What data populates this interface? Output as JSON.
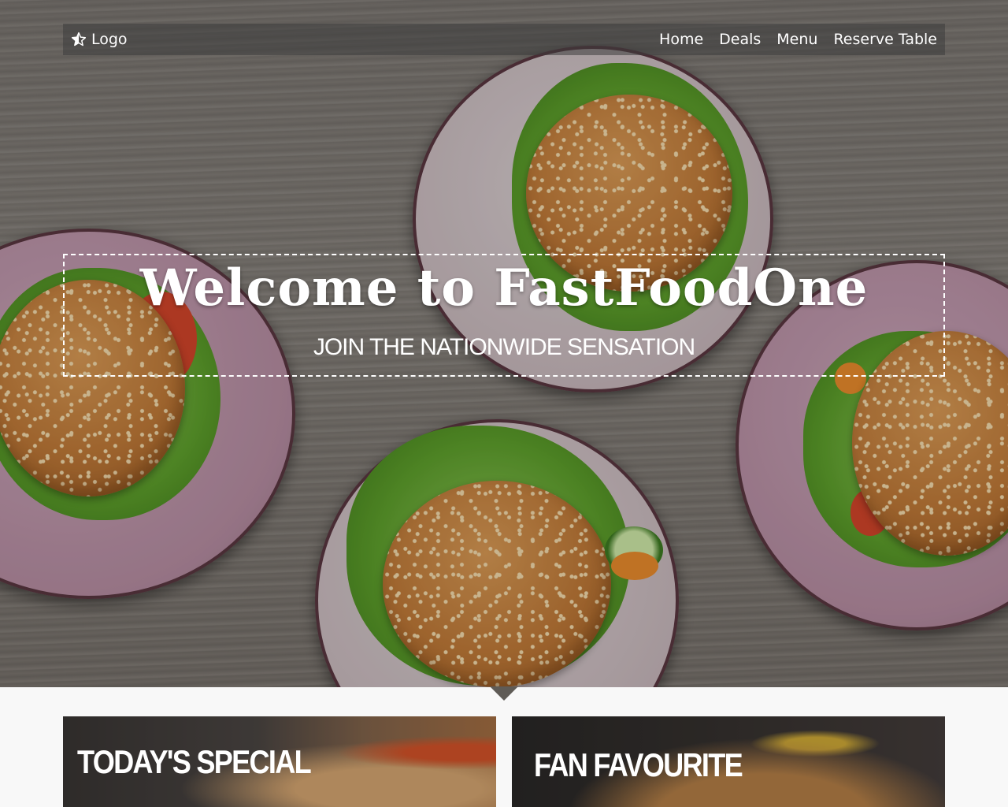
{
  "nav": {
    "logo_label": "Logo",
    "links": [
      "Home",
      "Deals",
      "Menu",
      "Reserve Table"
    ]
  },
  "hero": {
    "title": "Welcome to FastFoodOne",
    "subtitle": "JOIN THE NATIONWIDE SENSATION"
  },
  "cards": [
    {
      "title": "TODAY'S SPECIAL"
    },
    {
      "title": "FAN FAVOURITE"
    }
  ],
  "colors": {
    "nav_bg": "#3c3c3c",
    "text": "#ffffff",
    "page_bg": "#f8f8f8"
  }
}
